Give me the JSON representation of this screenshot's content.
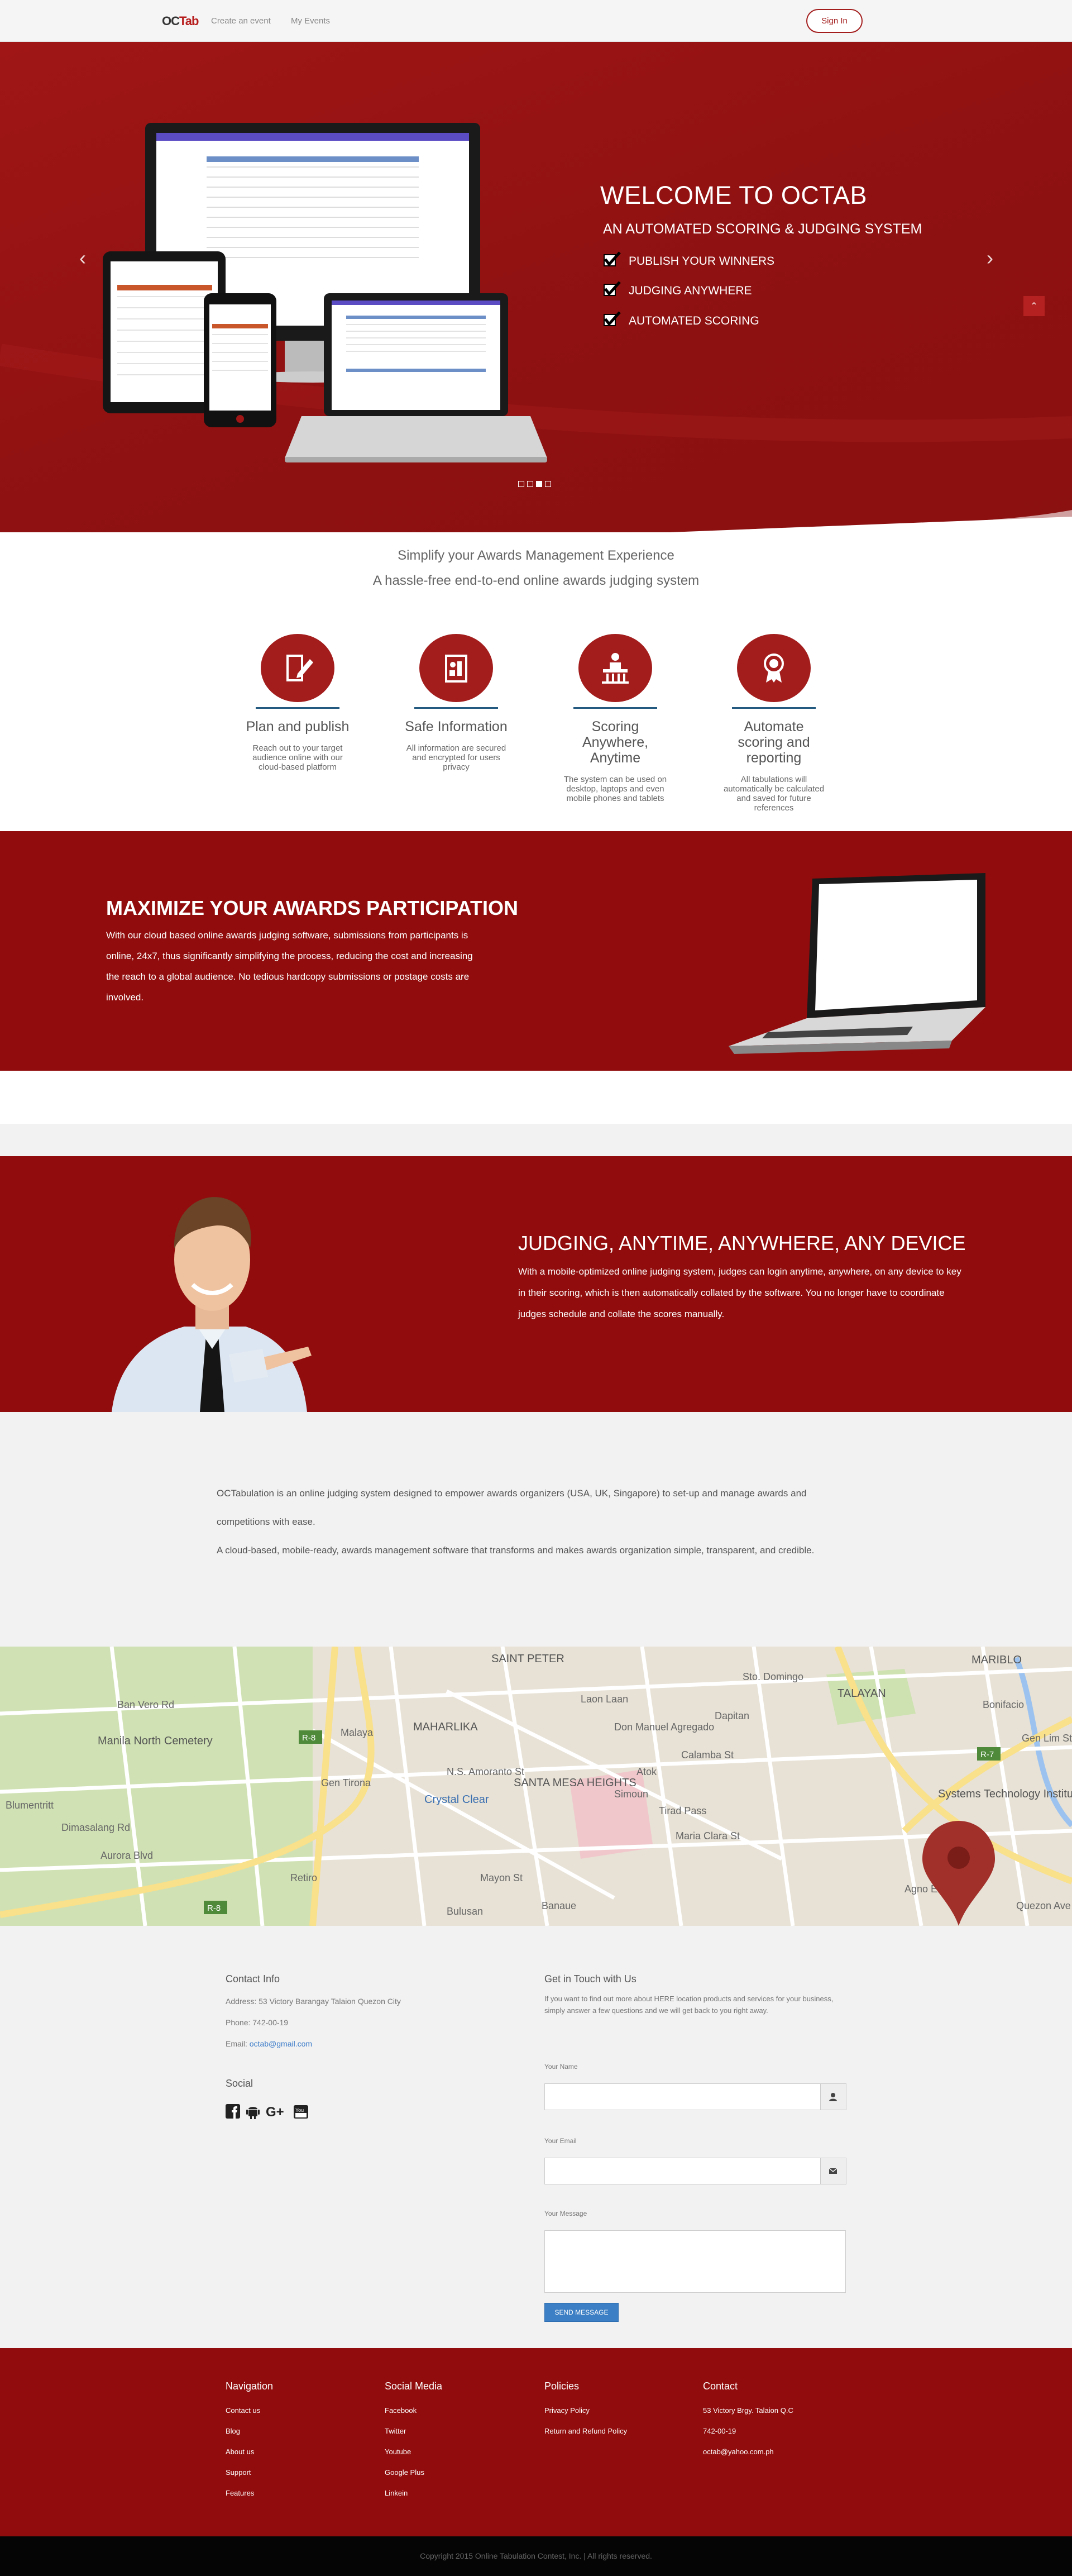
{
  "nav": {
    "logo_main": "OC",
    "logo_accent": "Tab",
    "links": [
      "Create an event",
      "My Events"
    ],
    "signin": "Sign In"
  },
  "hero": {
    "title": "WELCOME TO OCTAB",
    "subtitle": "AN AUTOMATED SCORING & JUDGING SYSTEM",
    "features": [
      "PUBLISH YOUR WINNERS",
      "JUDGING ANYWHERE",
      "AUTOMATED SCORING"
    ],
    "prev": "‹",
    "next": "›",
    "to_top": "⌃",
    "slides": 4,
    "active_slide": 2
  },
  "intro": {
    "line1": "Simplify your Awards Management Experience",
    "line2": "A hassle-free end-to-end online awards judging system"
  },
  "features": [
    {
      "title": "Plan and publish",
      "desc": "Reach out to your target audience online with our cloud-based platform",
      "icon": "pen-document-icon"
    },
    {
      "title": "Safe Information",
      "desc": "All information are secured and encrypted for users privacy",
      "icon": "secure-document-icon"
    },
    {
      "title": "Scoring Anywhere, Anytime",
      "desc": "The system can be used on desktop, laptops and even mobile phones and tablets",
      "icon": "podium-icon"
    },
    {
      "title": "Automate scoring and reporting",
      "desc": "All tabulations will automatically be calculated and saved for future references",
      "icon": "award-medal-icon"
    }
  ],
  "maximize": {
    "title": "MAXIMIZE YOUR AWARDS PARTICIPATION",
    "text": "With our cloud based online awards judging software, submissions from participants is online, 24x7, thus significantly simplifying the process, reducing the cost and increasing the reach to a global audience. No tedious hardcopy submissions or postage costs are involved."
  },
  "judging": {
    "title": "JUDGING, ANYTIME, ANYWHERE, ANY DEVICE",
    "text": "With a mobile-optimized online judging system, judges can login anytime, anywhere, on any device to key in their scoring, which is then automatically collated by the software. You no longer have to coordinate judges schedule and collate the scores manually."
  },
  "about": {
    "p1": "OCTabulation is an online judging system designed to empower awards organizers (USA, UK, Singapore) to set-up and manage awards and competitions with ease.",
    "p2": "A cloud-based, mobile-ready, awards management software that transforms and makes awards organization simple, transparent, and credible."
  },
  "map": {
    "labels": [
      "SAINT PETER",
      "MAHARLIKA",
      "Manila North Cemetery",
      "SANTA MESA HEIGHTS",
      "TALAYAN",
      "MARIBLO",
      "Systems Technology Institute",
      "Crystal Clear",
      "N.S. Amoranto St",
      "Maria Clara St",
      "Calamba St",
      "Don Manuel Agregado",
      "Gen Tirona",
      "Aurora Blvd",
      "Dimasalang Rd",
      "Ban Vero Rd",
      "Blumentritt",
      "Gen Lim St",
      "Bonifacio",
      "Simoun",
      "Mayon St",
      "Banaue",
      "Laon Laan",
      "Agno Ext",
      "Quezon Ave",
      "Malaya",
      "Bulusan",
      "Atok",
      "Tirad Pass",
      "Dapitan",
      "Sto. Domingo",
      "Retiro"
    ],
    "road_badges": [
      "R-8",
      "R-8",
      "R-7"
    ]
  },
  "contact": {
    "info_title": "Contact Info",
    "address": "Address: 53 Victory Barangay Talaion Quezon City",
    "phone": "Phone: 742-00-19",
    "email_label": "Email:",
    "email": "octab@gmail.com",
    "social_title": "Social",
    "social_icons": [
      "facebook-icon",
      "android-icon",
      "google-plus-icon",
      "youtube-icon"
    ],
    "form_title": "Get in Touch with Us",
    "form_intro": "If you want to find out more about HERE location products and services for your business, simply answer a few questions and we will get back to you right away.",
    "name_label": "Your Name",
    "email_field_label": "Your Email",
    "message_label": "Your Message",
    "send": "SEND MESSAGE"
  },
  "footer": {
    "nav_title": "Navigation",
    "nav_links": [
      "Contact us",
      "Blog",
      "About us",
      "Support",
      "Features"
    ],
    "social_title": "Social Media",
    "social_links": [
      "Facebook",
      "Twitter",
      "Youtube",
      "Google Plus",
      "Linkein"
    ],
    "policies_title": "Policies",
    "policies_links": [
      "Privacy Policy",
      "Return and Refund Policy"
    ],
    "contact_title": "Contact",
    "contact_items": [
      "53 Victory Brgy. Talaion Q.C",
      "742-00-19",
      "octab@yahoo.com.ph"
    ],
    "copyright": "Copyright 2015 Online Tabulation Contest, Inc. | All rights reserved."
  },
  "colors": {
    "brand_red": "#910d0d",
    "hero_red": "#a01616",
    "accent_blue": "#245a80",
    "button_blue": "#3c7fc4"
  }
}
